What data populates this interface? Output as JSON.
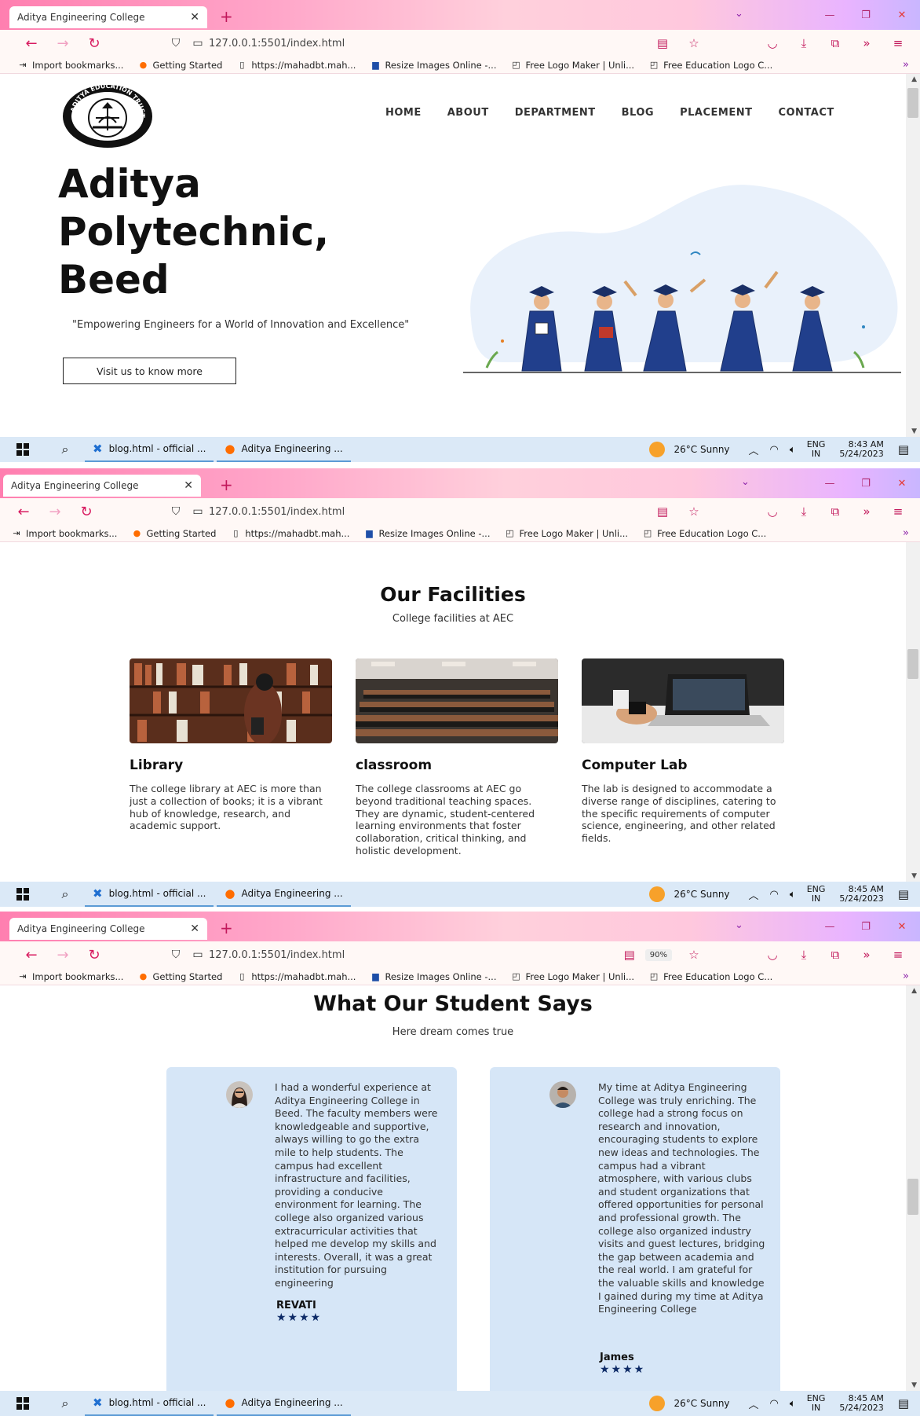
{
  "browser": {
    "tab_title": "Aditya Engineering College",
    "url": "127.0.0.1:5501/index.html",
    "zoom": "90%",
    "bookmarks": [
      "Import bookmarks...",
      "Getting Started",
      "https://mahadbt.mah...",
      "Resize Images Online -...",
      "Free Logo Maker | Unli...",
      "Free Education Logo C..."
    ]
  },
  "taskbar": {
    "apps": [
      "blog.html - official ...",
      "Aditya Engineering ..."
    ],
    "weather": "26°C  Sunny",
    "lang_top": "ENG",
    "lang_bottom": "IN",
    "date": "5/24/2023",
    "time_1": "8:43 AM",
    "time_2": "8:45 AM",
    "time_3": "8:45 AM"
  },
  "hero": {
    "logo_text": "ADITYA EDUCATION TRUST BEED",
    "nav": [
      "HOME",
      "ABOUT",
      "DEPARTMENT",
      "BLOG",
      "PLACEMENT",
      "CONTACT"
    ],
    "title_line1": "Aditya",
    "title_line2": "Polytechnic,",
    "title_line3": "Beed",
    "tagline": "\"Empowering Engineers for a World of Innovation and Excellence\"",
    "button": "Visit us to know more"
  },
  "facilities": {
    "title": "Our Facilities",
    "subtitle": "College facilities at AEC",
    "items": [
      {
        "name": "Library",
        "desc": "The college library at AEC is more than just a collection of books; it is a vibrant hub of knowledge, research, and academic support."
      },
      {
        "name": "classroom",
        "desc": "The college classrooms at AEC go beyond traditional teaching spaces. They are dynamic, student-centered learning environments that foster collaboration, critical thinking, and holistic development."
      },
      {
        "name": "Computer Lab",
        "desc": "The lab is designed to accommodate a diverse range of disciplines, catering to the specific requirements of computer science, engineering, and other related fields."
      }
    ]
  },
  "testimonials": {
    "title": "What Our Student Says",
    "subtitle": "Here dream comes true",
    "items": [
      {
        "name": "REVATI",
        "stars": "★★★★",
        "text": "I had a wonderful experience at Aditya Engineering College in Beed. The faculty members were knowledgeable and supportive, always willing to go the extra mile to help students. The campus had excellent infrastructure and facilities, providing a conducive environment for learning. The college also organized various extracurricular activities that helped me develop my skills and interests. Overall, it was a great institution for pursuing engineering"
      },
      {
        "name": "James",
        "stars": "★★★★",
        "text": "My time at Aditya Engineering College was truly enriching. The college had a strong focus on research and innovation, encouraging students to explore new ideas and technologies. The campus had a vibrant atmosphere, with various clubs and student organizations that offered opportunities for personal and professional growth. The college also organized industry visits and guest lectures, bridging the gap between academia and the real world. I am grateful for the valuable skills and knowledge I gained during my time at Aditya Engineering College"
      }
    ]
  }
}
